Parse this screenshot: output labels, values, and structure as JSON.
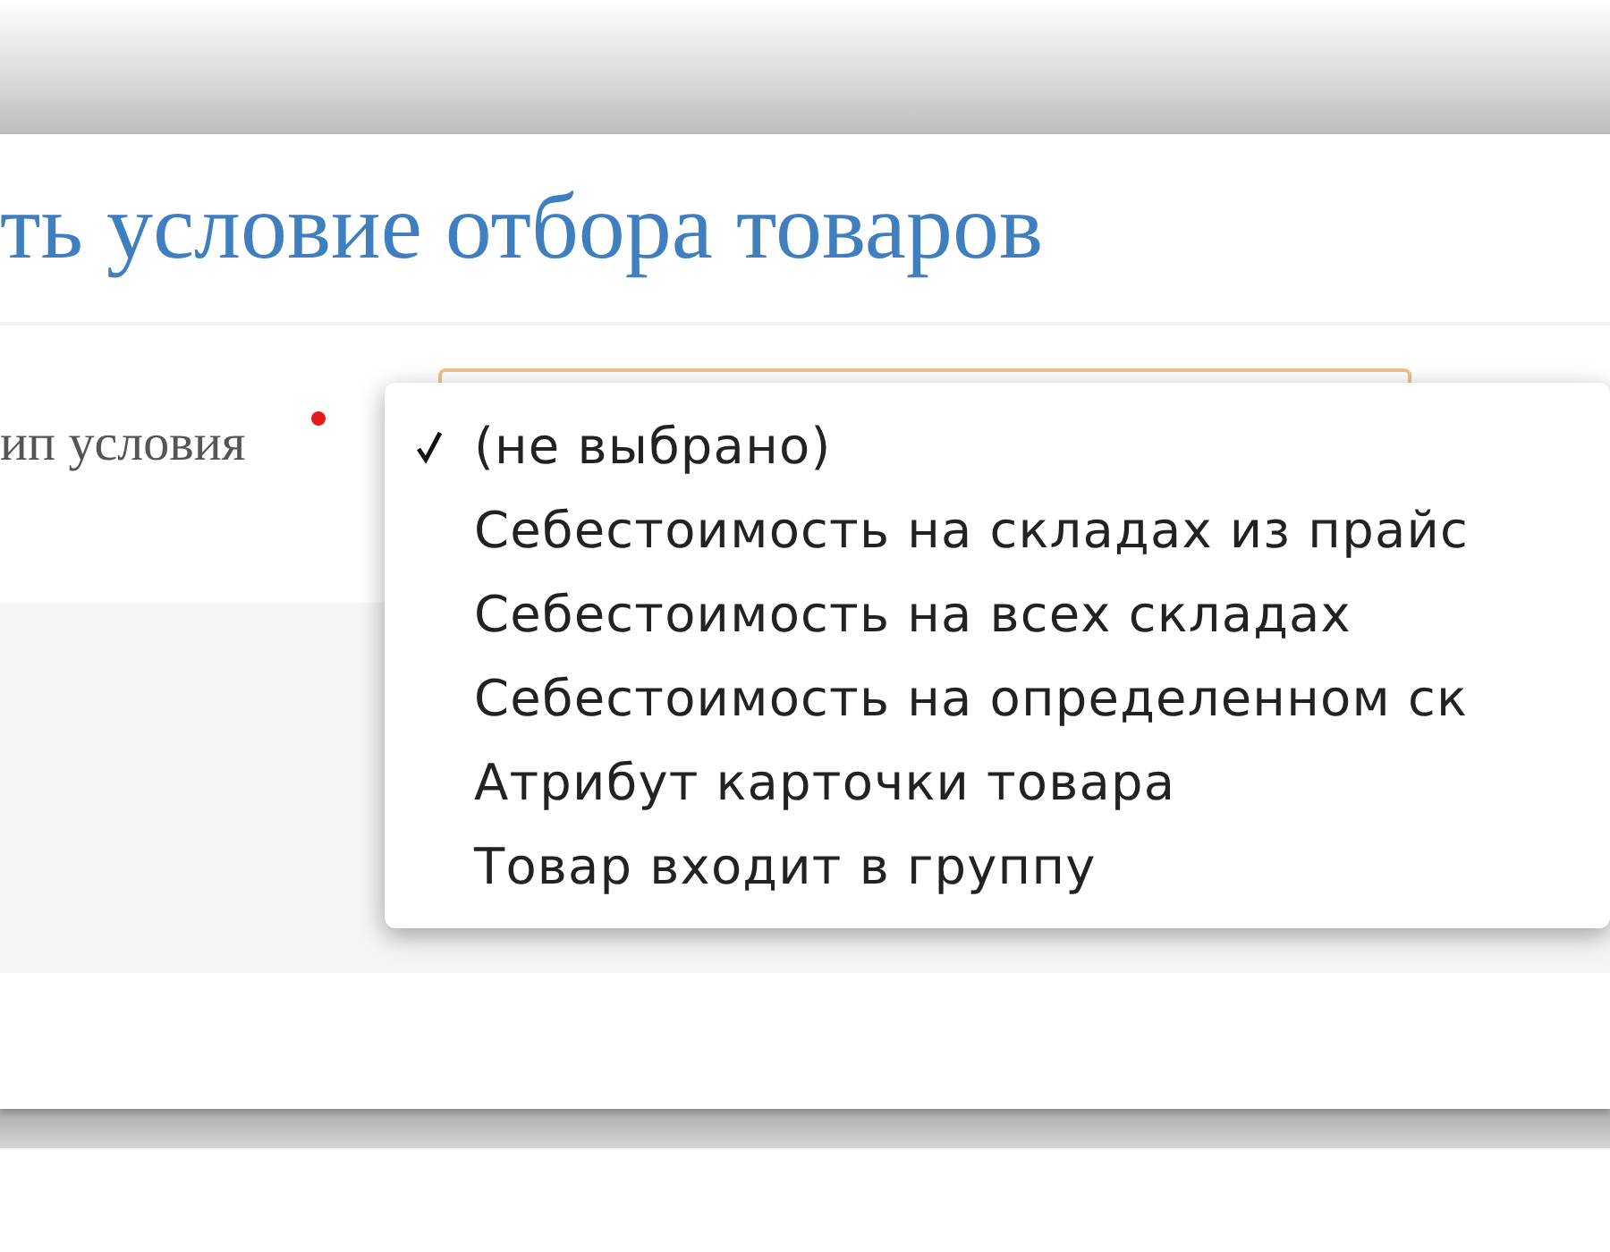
{
  "dialog": {
    "title": "ть условие отбора товаров",
    "field": {
      "label": "ип условия",
      "required": true
    }
  },
  "dropdown": {
    "options": [
      {
        "label": "(не выбрано)",
        "selected": true
      },
      {
        "label": "Себестоимость на складах из прайс",
        "selected": false
      },
      {
        "label": "Себестоимость на всех складах",
        "selected": false
      },
      {
        "label": "Себестоимость на определенном ск",
        "selected": false
      },
      {
        "label": "Атрибут карточки товара",
        "selected": false
      },
      {
        "label": "Товар входит в группу",
        "selected": false
      }
    ]
  }
}
